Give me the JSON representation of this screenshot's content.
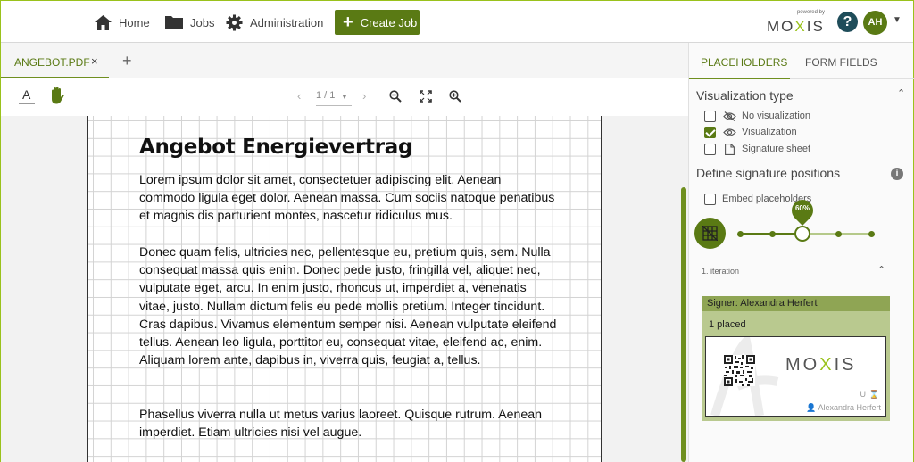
{
  "nav": {
    "home": "Home",
    "jobs": "Jobs",
    "administration": "Administration",
    "create_job": "Create Job"
  },
  "brand": {
    "powered": "powered by",
    "logo_left": "MO",
    "logo_x": "X",
    "logo_right": "IS"
  },
  "user": {
    "initials": "AH",
    "help": "?"
  },
  "doc_tabs": {
    "active": "ANGEBOT.PDF",
    "close": "×",
    "add": "+"
  },
  "toolbar": {
    "page_indicator": "1 / 1"
  },
  "document": {
    "title": "Angebot Energievertrag",
    "paragraphs": [
      "Lorem ipsum dolor sit amet, consectetuer adipiscing elit. Aenean commodo ligula eget dolor. Aenean massa. Cum sociis natoque penatibus et magnis dis parturient montes, nascetur ridiculus mus.",
      "Donec quam felis, ultricies nec, pellentesque eu, pretium quis, sem. Nulla consequat massa quis enim. Donec pede justo, fringilla vel, aliquet nec, vulputate eget, arcu. In enim justo, rhoncus ut, imperdiet a, venenatis vitae, justo. Nullam dictum felis eu pede mollis pretium. Integer tincidunt. Cras dapibus. Vivamus elementum semper nisi. Aenean vulputate eleifend tellus. Aenean leo ligula, porttitor eu, consequat vitae, eleifend ac, enim. Aliquam lorem ante, dapibus in, viverra quis, feugiat a, tellus.",
      "Phasellus viverra nulla ut metus varius laoreet. Quisque rutrum. Aenean imperdiet. Etiam ultricies nisi vel augue."
    ]
  },
  "side": {
    "tabs": [
      "PLACEHOLDERS",
      "FORM FIELDS"
    ],
    "visualization_type": "Visualization type",
    "options": [
      {
        "label": "No visualization",
        "checked": false
      },
      {
        "label": "Visualization",
        "checked": true
      },
      {
        "label": "Signature sheet",
        "checked": false
      }
    ],
    "define_positions": "Define signature positions",
    "embed_placeholders": "Embed placeholders",
    "slider_value": "60%",
    "iteration": "1. iteration",
    "signer": "Signer: Alexandra Herfert",
    "placed": "1 placed",
    "sig_name": "Alexandra Herfert",
    "sig_u": "U"
  },
  "colors": {
    "accent": "#5a7a14",
    "frame": "#9ac21c"
  }
}
